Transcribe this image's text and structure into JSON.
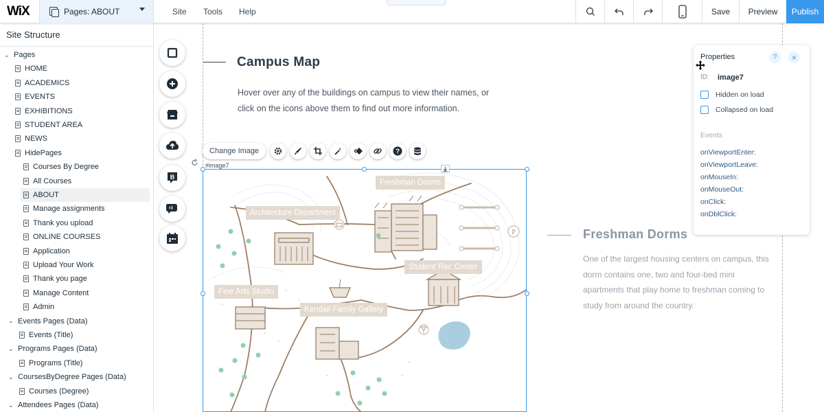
{
  "topbar": {
    "logo": "WiX",
    "page_selector": "Pages: ABOUT",
    "menu": [
      "Site",
      "Tools",
      "Help"
    ],
    "save": "Save",
    "preview": "Preview",
    "publish": "Publish"
  },
  "left_panel": {
    "title": "Site Structure",
    "tree": [
      {
        "label": "Pages",
        "kind": "caret"
      },
      {
        "label": "HOME",
        "kind": "doc"
      },
      {
        "label": "ACADEMICS",
        "kind": "doc"
      },
      {
        "label": "EVENTS",
        "kind": "doc"
      },
      {
        "label": "EXHIBITIONS",
        "kind": "doc"
      },
      {
        "label": "STUDENT AREA",
        "kind": "doc"
      },
      {
        "label": "NEWS",
        "kind": "doc"
      },
      {
        "label": "HidePages",
        "kind": "doc"
      },
      {
        "label": "Courses By Degree",
        "kind": "doc"
      },
      {
        "label": "All Courses",
        "kind": "doc"
      },
      {
        "label": "ABOUT",
        "kind": "doc",
        "selected": true
      },
      {
        "label": "Manage assignments",
        "kind": "doc"
      },
      {
        "label": "Thank you upload",
        "kind": "doc"
      },
      {
        "label": "ONLINE COURSES",
        "kind": "doc"
      },
      {
        "label": "Application",
        "kind": "doc"
      },
      {
        "label": "Upload Your Work",
        "kind": "doc"
      },
      {
        "label": "Thank you page",
        "kind": "doc"
      },
      {
        "label": "Manage Content",
        "kind": "doc"
      },
      {
        "label": "Admin",
        "kind": "doc"
      },
      {
        "label": "Events Pages (Data)",
        "kind": "caret"
      },
      {
        "label": "Events (Title)",
        "kind": "doc"
      },
      {
        "label": "Programs Pages (Data)",
        "kind": "caret"
      },
      {
        "label": "Programs (Title)",
        "kind": "doc"
      },
      {
        "label": "CoursesByDegree Pages (Data)",
        "kind": "caret"
      },
      {
        "label": "Courses (Degree)",
        "kind": "doc"
      },
      {
        "label": "Attendees Pages (Data)",
        "kind": "caret"
      }
    ]
  },
  "content": {
    "campus_title": "Campus Map",
    "campus_text": "Hover over any of the buildings on campus to view their names, or click on the icons above them to find out more information.",
    "fresh_title": "Freshman Dorms",
    "fresh_text": "One of the largest housing centers on campus, this dorm contains one, two and four-bed mini apartments that play home to freshman coming to study from around the country."
  },
  "image_toolbar": {
    "change_image": "Change Image",
    "element_id": "#image7"
  },
  "map_labels": {
    "freshman": "Freshman Dorms",
    "architecture": "Architecture Department",
    "rec": "Student Rec Center",
    "fine_arts": "Fine Arts Studio",
    "kendall": "Kendall Family Gallery"
  },
  "properties": {
    "title": "Properties",
    "help": "?",
    "close": "×",
    "id_label": "ID:",
    "id_value": "image7",
    "hidden_on_load": "Hidden on load",
    "collapsed_on_load": "Collapsed on load",
    "events_header": "Events",
    "events": [
      "onViewportEnter:",
      "onViewportLeave:",
      "onMouseIn:",
      "onMouseOut:",
      "onClick:",
      "onDblClick:"
    ]
  },
  "colors": {
    "accent": "#3899ec",
    "map_beige": "#e3d9cf",
    "map_line": "#9c8068",
    "tree_green": "#8fcfb4"
  }
}
